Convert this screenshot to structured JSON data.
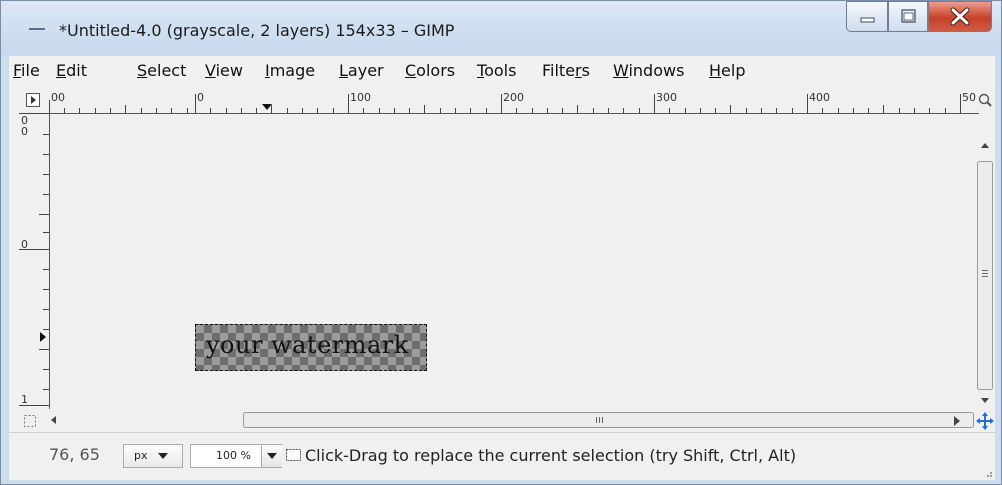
{
  "window": {
    "title": "*Untitled-4.0 (grayscale, 2 layers) 154x33 – GIMP",
    "controls": {
      "minimize": "minimize",
      "maximize": "maximize",
      "close": "close"
    }
  },
  "menu": {
    "items": [
      {
        "pre": "",
        "key": "F",
        "post": "ile"
      },
      {
        "pre": "",
        "key": "E",
        "post": "dit"
      },
      {
        "pre": "",
        "key": "S",
        "post": "elect"
      },
      {
        "pre": "",
        "key": "V",
        "post": "iew"
      },
      {
        "pre": "",
        "key": "I",
        "post": "mage"
      },
      {
        "pre": "",
        "key": "L",
        "post": "ayer"
      },
      {
        "pre": "",
        "key": "C",
        "post": "olors"
      },
      {
        "pre": "",
        "key": "T",
        "post": "ools"
      },
      {
        "pre": "Filte",
        "key": "r",
        "post": "s"
      },
      {
        "pre": "",
        "key": "W",
        "post": "indows"
      },
      {
        "pre": "",
        "key": "H",
        "post": "elp"
      }
    ]
  },
  "ruler": {
    "horizontal_labels": [
      "00",
      "0",
      "100",
      "200",
      "300",
      "400",
      "50"
    ],
    "vertical_labels": [
      "0\n0",
      "0",
      "1"
    ]
  },
  "canvas": {
    "watermark_text": "your watermark"
  },
  "status": {
    "coords": "76, 65",
    "unit": "px",
    "zoom": "100 %",
    "message": "Click-Drag to replace the current selection (try Shift, Ctrl, Alt)"
  },
  "icons": {
    "nav": "navigate-icon",
    "zoom": "zoom-fit-icon",
    "quickmask": "quick-mask-icon",
    "move": "move-icon"
  }
}
